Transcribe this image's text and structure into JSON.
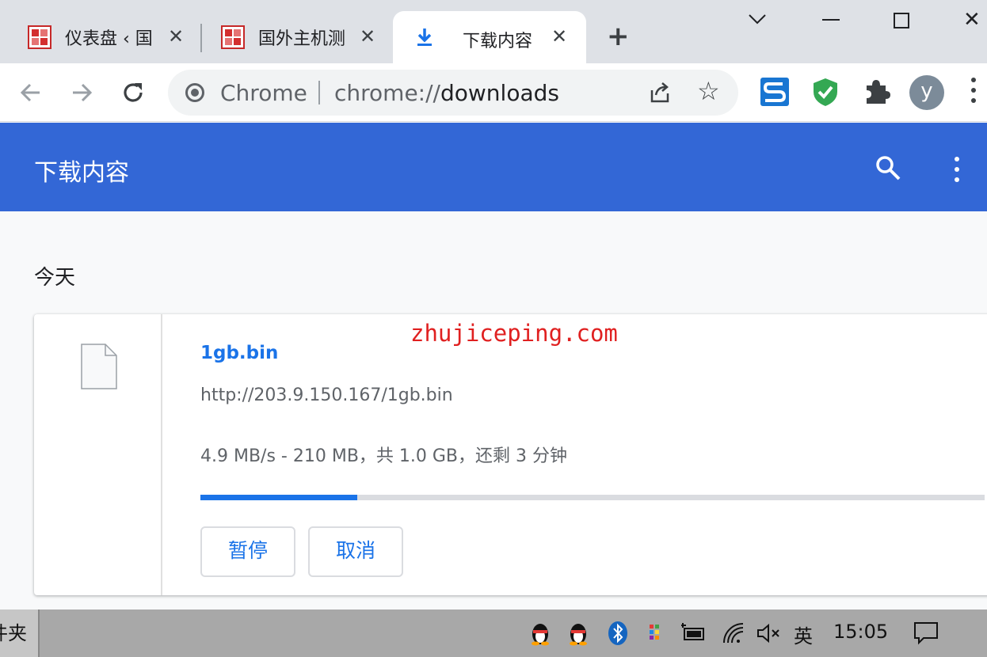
{
  "tabs": [
    {
      "title": "仪表盘 ‹ 国",
      "icon": "site-favicon"
    },
    {
      "title": "国外主机测",
      "icon": "site-favicon"
    },
    {
      "title": "下载内容",
      "icon": "download-icon"
    }
  ],
  "new_tab_label": "+",
  "omnibox": {
    "site_label": "Chrome",
    "url_scheme": "chrome://",
    "url_path": "downloads"
  },
  "avatar_letter": "y",
  "page": {
    "header_title": "下载内容",
    "section_label": "今天",
    "download": {
      "file_name": "1gb.bin",
      "url": "http://203.9.150.167/1gb.bin",
      "status": "4.9 MB/s - 210 MB，共 1.0 GB，还剩 3 分钟",
      "progress_fraction": 0.2,
      "pause_label": "暂停",
      "cancel_label": "取消"
    }
  },
  "watermark": "zhujiceping.com",
  "taskbar": {
    "app_label": "件夹",
    "ime_label": "英",
    "clock": "15:05"
  },
  "colors": {
    "accent": "#1a73e8",
    "header": "#3367d6",
    "watermark": "#e02020"
  }
}
